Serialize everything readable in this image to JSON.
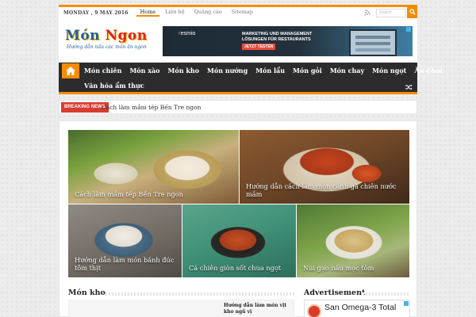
{
  "topbar": {
    "date": "MONDAY , 9 MAY 2016",
    "nav": [
      "Home",
      "Liên hệ",
      "Quảng cáo",
      "Sitemap"
    ],
    "search_placeholder": "Search"
  },
  "header": {
    "logo_part1": "Món ",
    "logo_part2": "Ngon",
    "logo_tagline": "Hướng dẫn nấu các món ăn ngon",
    "ad": {
      "brand_r": "r",
      "brand_rest": "esmio",
      "line1": "MARKETING UND MANAGEMENT",
      "line2": "LÖSUNGEN FÜR RESTAURANTS",
      "cta": "JETZT TESTEN"
    }
  },
  "mainnav": {
    "row1": [
      "Món chiên",
      "Món xào",
      "Món kho",
      "Món nướng",
      "Món lẩu",
      "Món gỏi",
      "Món chay",
      "Món ngọt",
      "Ăn Chơi"
    ],
    "row2": [
      "Văn hóa ẩm thực"
    ]
  },
  "breaking": {
    "label": "BREAKING NEWS",
    "headline": "Cách làm mắm tép Bến Tre ngon"
  },
  "featured": [
    {
      "caption": "Cách làm mắm tép Bến Tre ngon"
    },
    {
      "caption": "Hướng dẫn cách làm món cánh gà chiên nước mắm"
    },
    {
      "caption": "Hướng dẫn làm món bánh đúc tôm thịt"
    },
    {
      "caption": "Cá chiên giòn sốt chua ngọt"
    },
    {
      "caption": "Nui gạo nấu mọc tôm"
    }
  ],
  "sections": {
    "mon_kho_title": "Món kho",
    "mon_kho_post": "Hướng dẫn làm món vịt kho ngũ vị",
    "ad_title": "Advertisement",
    "ad_text": "San Omega-3 Total"
  },
  "colors": {
    "accent": "#f88c00",
    "nav_bg": "#2c2c2c",
    "breaking": "#d83c2f",
    "logo_blue": "#1f5fa0",
    "logo_red": "#e2231a"
  }
}
